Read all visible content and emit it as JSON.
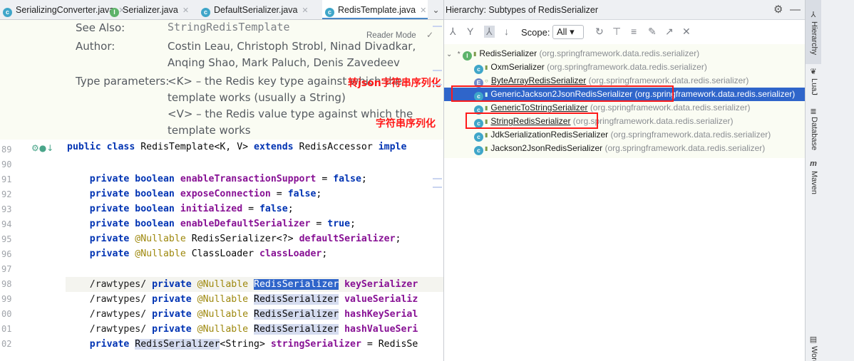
{
  "tabs": [
    {
      "label": "SerializingConverter.java",
      "icon": "class"
    },
    {
      "label": "Serializer.java",
      "icon": "interface"
    },
    {
      "label": "DefaultSerializer.java",
      "icon": "class"
    },
    {
      "label": "RedisTemplate.java",
      "icon": "class",
      "active": true
    }
  ],
  "editor": {
    "javadoc": {
      "see_also_key": "See Also:",
      "see_also_value": "StringRedisTemplate",
      "author_key": "Author:",
      "author_line1": "Costin Leau, Christoph Strobl, Ninad Divadkar,",
      "author_line2": "Anqing Shao, Mark Paluch, Denis Zavedeev",
      "type_params_key": "Type parameters:",
      "tp_line1": "<K> – the Redis key type against which the",
      "tp_line2": "template works (usually a String)",
      "tp_line3": "<V> – the Redis value type against which the",
      "tp_line4": "template works",
      "reader_mode": "Reader Mode"
    },
    "annotations": {
      "json": "转json字符串序列化",
      "string": "字符串序列化"
    },
    "line_numbers": [
      "89",
      "90",
      "91",
      "92",
      "93",
      "94",
      "95",
      "96",
      "97",
      "98",
      "99",
      "00",
      "01",
      "02"
    ]
  },
  "hierarchy": {
    "title": "Hierarchy:  Subtypes of RedisSerializer",
    "scope_label": "Scope:",
    "scope_value": "All",
    "root": {
      "name": "RedisSerializer",
      "pkg": "(org.springframework.data.redis.serializer)"
    },
    "items": [
      {
        "name": "OxmSerializer",
        "pkg": "(org.springframework.data.redis.serializer)",
        "icon": "class"
      },
      {
        "name": "ByteArrayRedisSerializer",
        "pkg": "(org.springframework.data.redis.serializer)",
        "icon": "enum"
      },
      {
        "name": "GenericJackson2JsonRedisSerializer",
        "pkg": "(org.springframework.data.redis.serializer)",
        "icon": "class",
        "selected": true
      },
      {
        "name": "GenericToStringSerializer",
        "pkg": "(org.springframework.data.redis.serializer)",
        "icon": "class"
      },
      {
        "name": "StringRedisSerializer",
        "pkg": "(org.springframework.data.redis.serializer)",
        "icon": "class"
      },
      {
        "name": "JdkSerializationRedisSerializer",
        "pkg": "(org.springframework.data.redis.serializer)",
        "icon": "class"
      },
      {
        "name": "Jackson2JsonRedisSerializer",
        "pkg": "(org.springframework.data.redis.serializer)",
        "icon": "class"
      }
    ]
  },
  "side_tools": {
    "hierarchy": "Hierarchy",
    "luaj": "LuaJ",
    "database": "Database",
    "maven": "Maven",
    "word": "Word"
  }
}
